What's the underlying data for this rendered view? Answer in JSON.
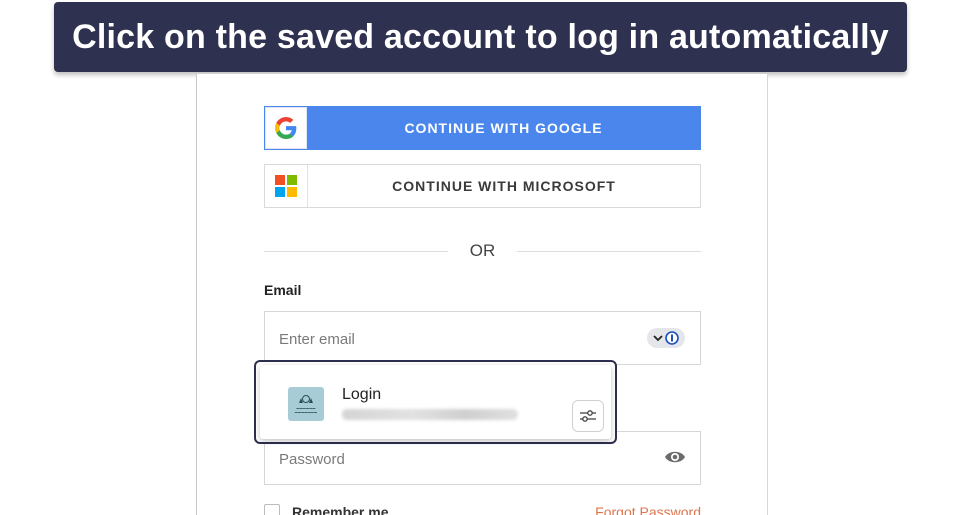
{
  "banner": {
    "text": "Click on the saved account to log in automatically"
  },
  "login_form": {
    "google_button": {
      "label": "CONTINUE WITH GOOGLE",
      "icon": "google-g-icon",
      "color": "#4a86ec"
    },
    "microsoft_button": {
      "label": "CONTINUE WITH MICROSOFT",
      "icon": "microsoft-logo-icon"
    },
    "divider_text": "OR",
    "email": {
      "label": "Email",
      "placeholder": "Enter email",
      "value": ""
    },
    "password": {
      "placeholder": "Password",
      "value": ""
    },
    "remember_label": "Remember me",
    "forgot_label": "Forgot Password"
  },
  "autofill_popup": {
    "title": "Login",
    "site_icon": "site-logo-icon",
    "settings_icon": "sliders-icon"
  },
  "colors": {
    "banner_bg": "#2f3150",
    "google_blue": "#4a86ec",
    "popup_highlight": "#2d2f4e",
    "link_orange": "#e0744d"
  }
}
